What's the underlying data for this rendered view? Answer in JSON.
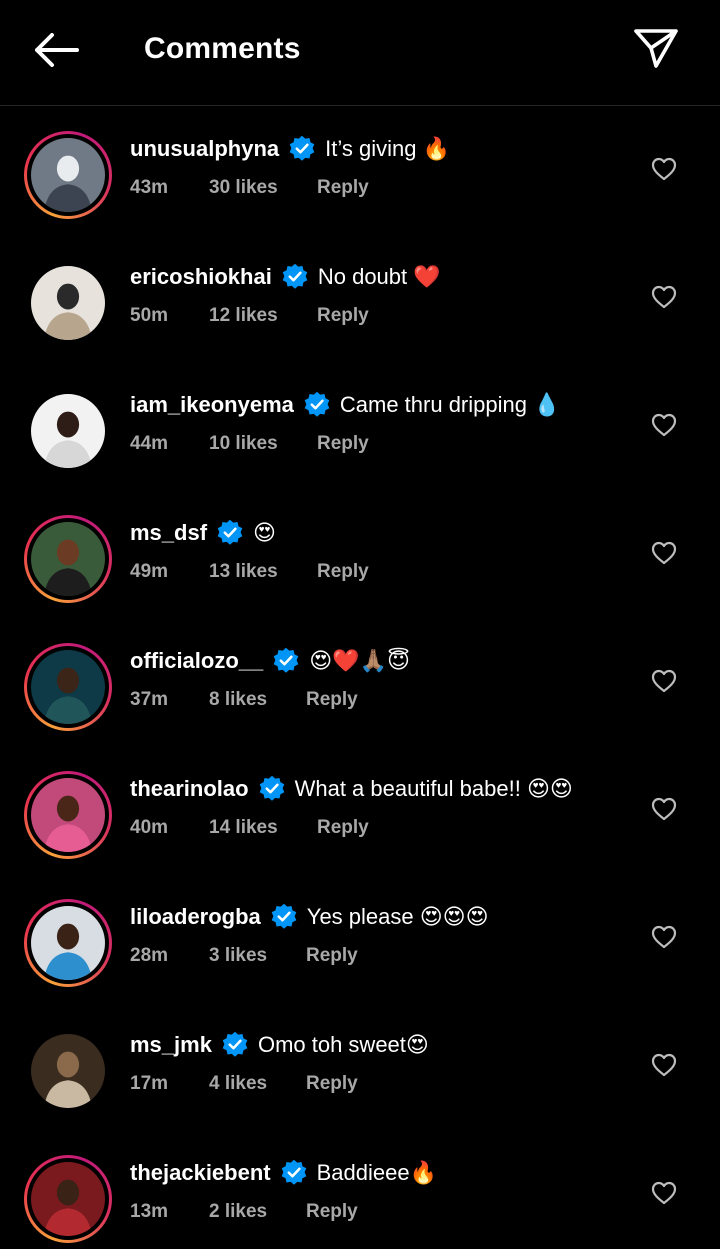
{
  "header": {
    "title": "Comments",
    "back_icon": "arrow-left-icon",
    "share_icon": "paper-plane-icon"
  },
  "comments": [
    {
      "username": "unusualphyna",
      "text": "It’s giving 🔥",
      "time": "43m",
      "likes": "30 likes",
      "reply": "Reply",
      "avatar_colors": [
        "#6f7a86",
        "#e9ecef",
        "#3b4450"
      ]
    },
    {
      "username": "ericoshiokhai",
      "text": "No doubt ❤️",
      "time": "50m",
      "likes": "12 likes",
      "reply": "Reply",
      "avatar_colors": [
        "#e7e2dc",
        "#2a2a2a",
        "#b7a58d"
      ]
    },
    {
      "username": "iam_ikeonyema",
      "text": "Came thru dripping 💧",
      "time": "44m",
      "likes": "10 likes",
      "reply": "Reply",
      "avatar_colors": [
        "#f2f2f2",
        "#2d1d16",
        "#d7d7d7"
      ]
    },
    {
      "username": "ms_dsf",
      "text": "😍",
      "time": "49m",
      "likes": "13 likes",
      "reply": "Reply",
      "avatar_colors": [
        "#3a5b3a",
        "#6b3b24",
        "#1d1d1d"
      ]
    },
    {
      "username": "officialozo__",
      "text": "😍❤️🙏🏽😇",
      "time": "37m",
      "likes": "8 likes",
      "reply": "Reply",
      "avatar_colors": [
        "#0d3a46",
        "#3b2519",
        "#20555a"
      ]
    },
    {
      "username": "thearinolao",
      "text": "What a beautiful babe!! 😍😍",
      "time": "40m",
      "likes": "14 likes",
      "reply": "Reply",
      "avatar_colors": [
        "#c24a7a",
        "#4a2618",
        "#e55d93"
      ]
    },
    {
      "username": "liloaderogba",
      "text": "Yes please 😍😍😍",
      "time": "28m",
      "likes": "3 likes",
      "reply": "Reply",
      "avatar_colors": [
        "#d7dde2",
        "#3a2216",
        "#2e8fcf"
      ]
    },
    {
      "username": "ms_jmk",
      "text": "Omo toh sweet😍",
      "time": "17m",
      "likes": "4 likes",
      "reply": "Reply",
      "avatar_colors": [
        "#3a2c1f",
        "#8a6a4a",
        "#c9b8a2"
      ]
    },
    {
      "username": "thejackiebent",
      "text": "Baddieee🔥",
      "time": "13m",
      "likes": "2 likes",
      "reply": "Reply",
      "avatar_colors": [
        "#7a1a1e",
        "#3a2216",
        "#b22a2f"
      ]
    }
  ],
  "rings": [
    true,
    false,
    false,
    true,
    true,
    true,
    true,
    false,
    true
  ],
  "accent": "#0095f6"
}
